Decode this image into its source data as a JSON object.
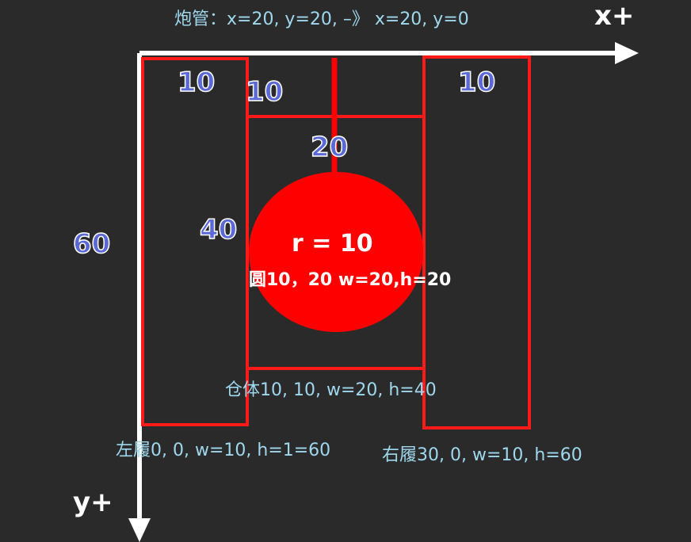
{
  "axes": {
    "x_label": "x+",
    "y_label": "y+"
  },
  "shapes": {
    "left_track": {
      "label": "左履0, 0, w=10, h=1=60"
    },
    "right_track": {
      "label": "右履30, 0, w=10, h=60"
    },
    "hull": {
      "label": "仓体10, 10, w=20, h=40"
    },
    "turret": {
      "label": "圆10，20 w=20,h=20",
      "radius_label": "r = 10"
    },
    "barrel": {
      "label": "炮管：x=20, y=20, –》 x=20, y=0"
    }
  },
  "dimensions": {
    "left_track_width": "10",
    "barrel_gap": "10",
    "right_track_width": "10",
    "barrel_length": "20",
    "hull_height": "40",
    "total_height": "60"
  },
  "colors": {
    "background": "#2a2a2a",
    "outline": "#ff1a1a",
    "turret_fill": "#ff0000",
    "axis": "#ffffff",
    "caption": "#9fd8ee",
    "dimension": "#5a68d8"
  }
}
